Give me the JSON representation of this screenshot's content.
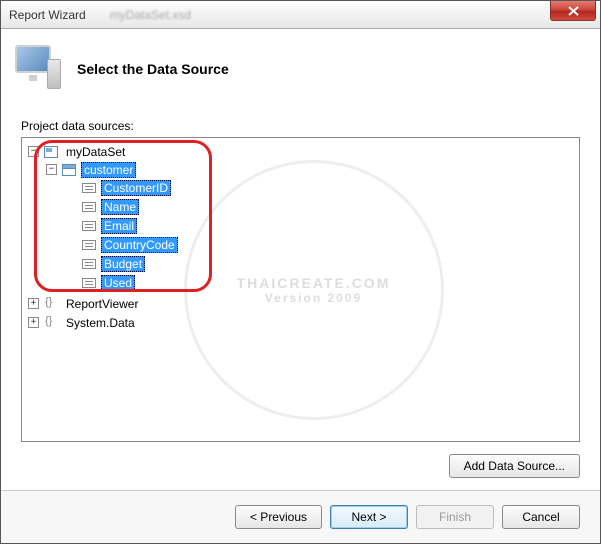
{
  "window": {
    "title": "Report Wizard"
  },
  "header": {
    "heading": "Select the Data Source"
  },
  "labels": {
    "project_sources": "Project data sources:"
  },
  "tree": {
    "myDataSet": {
      "label": "myDataSet",
      "customer": {
        "label": "customer",
        "fields": [
          "CustomerID",
          "Name",
          "Email",
          "CountryCode",
          "Budget",
          "Used"
        ]
      }
    },
    "reportViewer": {
      "label": "ReportViewer"
    },
    "systemData": {
      "label": "System.Data"
    }
  },
  "buttons": {
    "add_ds": "Add Data Source...",
    "prev": "< Previous",
    "next": "Next >",
    "finish": "Finish",
    "cancel": "Cancel"
  },
  "watermark": {
    "l1": "THAICREATE.COM",
    "l2": "Version 2009"
  }
}
